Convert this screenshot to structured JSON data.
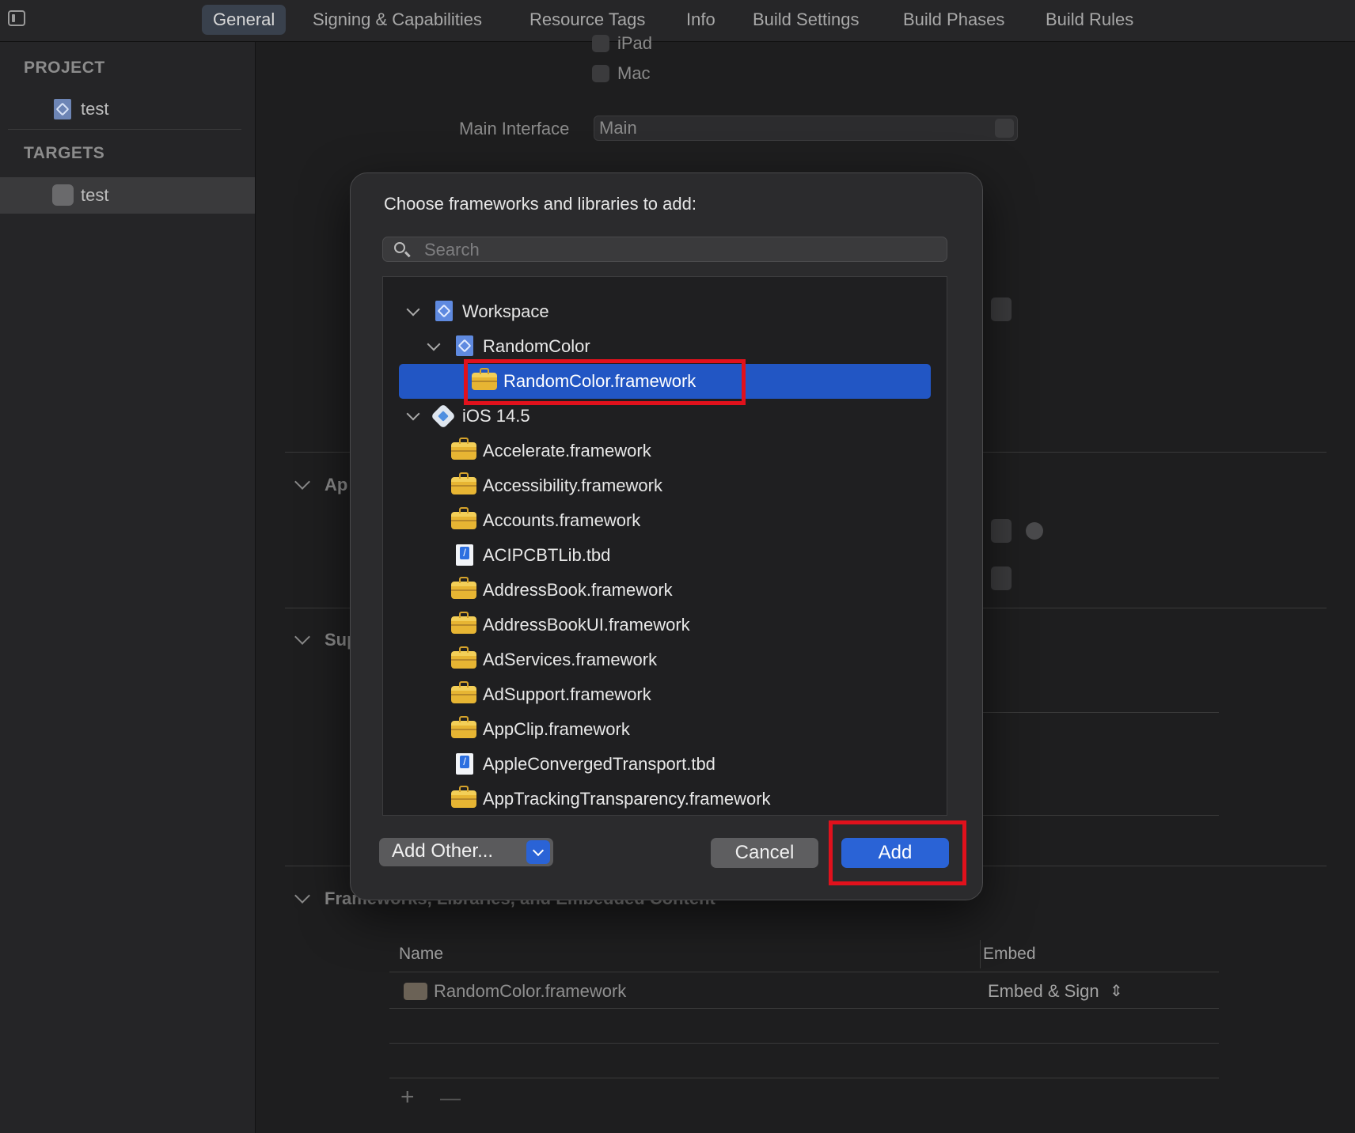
{
  "tabs": [
    "General",
    "Signing & Capabilities",
    "Resource Tags",
    "Info",
    "Build Settings",
    "Build Phases",
    "Build Rules"
  ],
  "sidebar": {
    "project_header": "PROJECT",
    "project_item": "test",
    "targets_header": "TARGETS",
    "target_item": "test"
  },
  "background": {
    "ipad_label": "iPad",
    "mac_label": "Mac",
    "main_interface_label": "Main Interface",
    "main_interface_value": "Main",
    "section_app_partial": "Ap",
    "section_supported_partial": "Sup",
    "section_frameworks": "Frameworks, Libraries, and Embedded Content",
    "table": {
      "col_name": "Name",
      "col_embed": "Embed",
      "row_name": "RandomColor.framework",
      "row_embed": "Embed & Sign"
    },
    "add_symbol": "+",
    "remove_symbol": "—"
  },
  "dialog": {
    "title": "Choose frameworks and libraries to add:",
    "search_placeholder": "Search",
    "tree": [
      {
        "label": "Workspace",
        "icon": "project-icon",
        "level": 0,
        "expanded": true
      },
      {
        "label": "RandomColor",
        "icon": "project-icon",
        "level": 1,
        "expanded": true
      },
      {
        "label": "RandomColor.framework",
        "icon": "framework-icon",
        "level": 2,
        "selected": true
      },
      {
        "label": "iOS 14.5",
        "icon": "sdk-icon",
        "level": 0,
        "expanded": true
      },
      {
        "label": "Accelerate.framework",
        "icon": "framework-icon",
        "level": 1
      },
      {
        "label": "Accessibility.framework",
        "icon": "framework-icon",
        "level": 1
      },
      {
        "label": "Accounts.framework",
        "icon": "framework-icon",
        "level": 1
      },
      {
        "label": "ACIPCBTLib.tbd",
        "icon": "tbd-icon",
        "level": 1
      },
      {
        "label": "AddressBook.framework",
        "icon": "framework-icon",
        "level": 1
      },
      {
        "label": "AddressBookUI.framework",
        "icon": "framework-icon",
        "level": 1
      },
      {
        "label": "AdServices.framework",
        "icon": "framework-icon",
        "level": 1
      },
      {
        "label": "AdSupport.framework",
        "icon": "framework-icon",
        "level": 1
      },
      {
        "label": "AppClip.framework",
        "icon": "framework-icon",
        "level": 1
      },
      {
        "label": "AppleConvergedTransport.tbd",
        "icon": "tbd-icon",
        "level": 1
      },
      {
        "label": "AppTrackingTransparency.framework",
        "icon": "framework-icon",
        "level": 1
      }
    ],
    "add_other_label": "Add Other...",
    "cancel_label": "Cancel",
    "add_label": "Add"
  },
  "colors": {
    "accent": "#2a63d6",
    "selection": "#2256c4",
    "highlight_box": "#e1111c"
  }
}
